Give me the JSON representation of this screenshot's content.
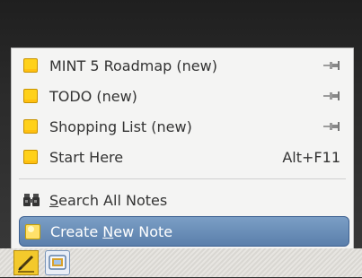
{
  "menu": {
    "notes": [
      {
        "label": "MINT 5 Roadmap (new)",
        "pinned": true
      },
      {
        "label": "TODO (new)",
        "pinned": true
      },
      {
        "label": "Shopping List (new)",
        "pinned": true
      },
      {
        "label": "Start Here",
        "shortcut": "Alt+F11"
      }
    ],
    "search": {
      "pre": "",
      "accel": "S",
      "post": "earch All Notes"
    },
    "create": {
      "pre": "Create ",
      "accel": "N",
      "post": "ew Note"
    }
  },
  "panel": {
    "buttons": [
      "tomboy-notes",
      "workspace"
    ]
  },
  "colors": {
    "note_icon": "#ffd11a",
    "highlight": "#5b7fab",
    "menu_bg": "#f4f4f3"
  }
}
